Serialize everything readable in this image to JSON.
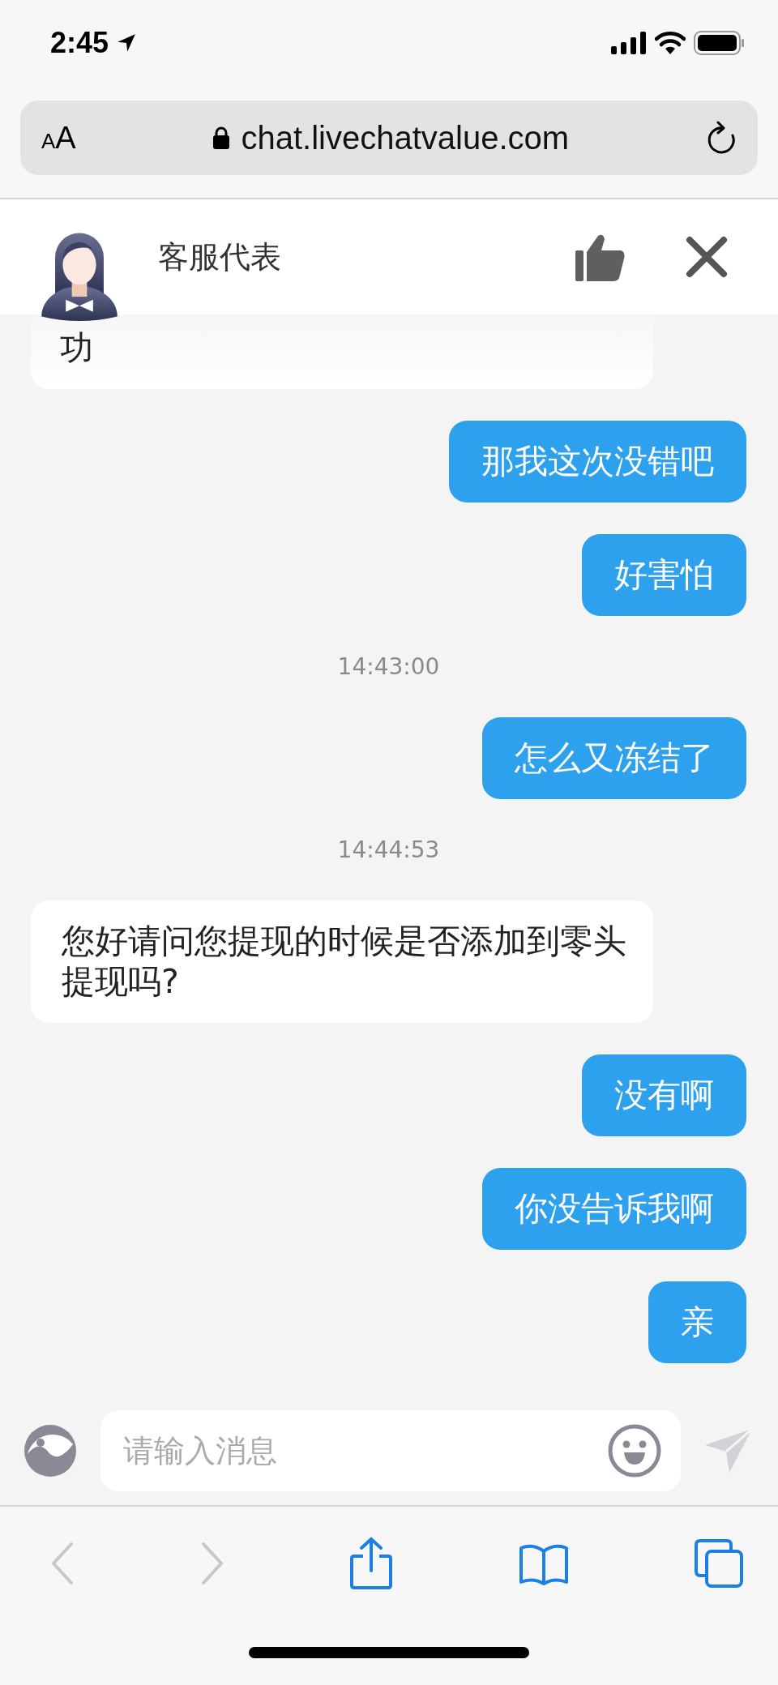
{
  "status_bar": {
    "time": "2:45"
  },
  "address_bar": {
    "text_size_button": "AA",
    "url": "chat.livechatvalue.com"
  },
  "header": {
    "title": "客服代表"
  },
  "messages": [
    {
      "kind": "received",
      "text": "功",
      "cut": true
    },
    {
      "kind": "sent",
      "text": "那我这次没错吧"
    },
    {
      "kind": "sent",
      "text": "好害怕"
    },
    {
      "kind": "time",
      "text": "14:43:00"
    },
    {
      "kind": "sent",
      "text": "怎么又冻结了"
    },
    {
      "kind": "time",
      "text": "14:44:53"
    },
    {
      "kind": "received",
      "text": "您好请问您提现的时候是否添加到零头提现吗?"
    },
    {
      "kind": "sent",
      "text": "没有啊"
    },
    {
      "kind": "sent",
      "text": "你没告诉我啊"
    },
    {
      "kind": "sent",
      "text": "亲"
    }
  ],
  "composer": {
    "placeholder": "请输入消息"
  },
  "toolbar": {
    "back": {
      "disabled": true
    },
    "forward": {
      "disabled": true
    }
  }
}
